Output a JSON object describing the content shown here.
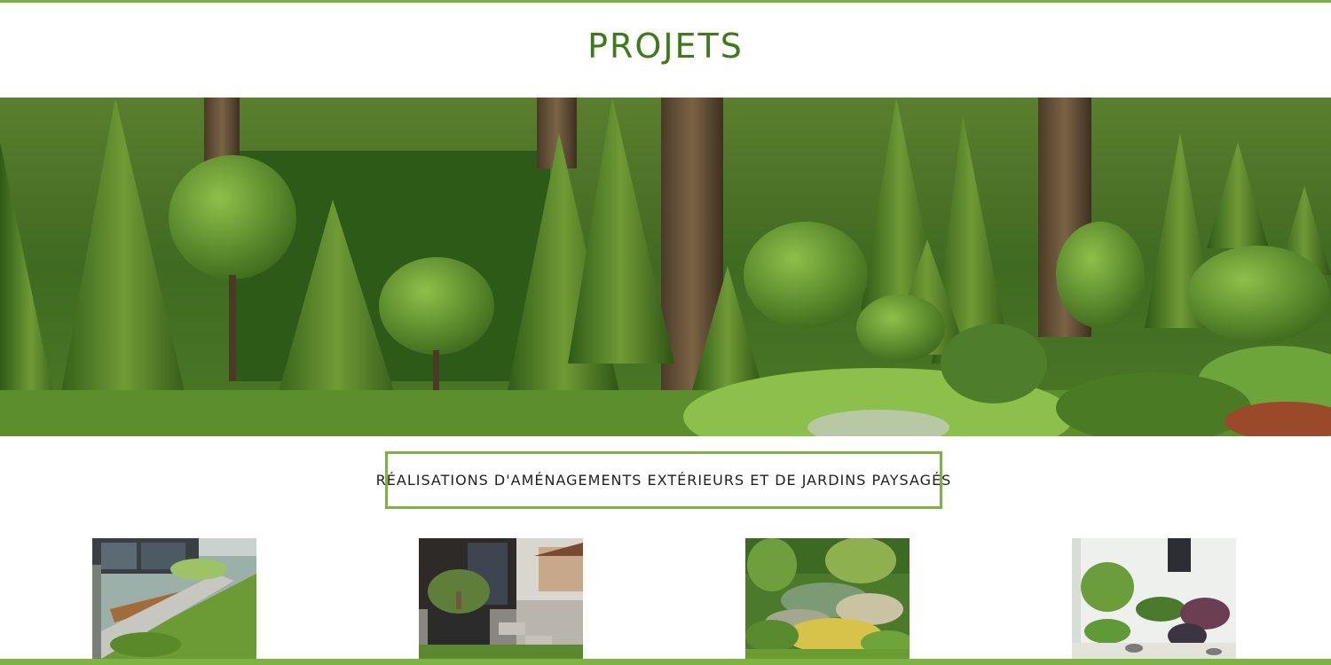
{
  "page": {
    "title": "Projets",
    "subtitle": "Réalisations d'aménagements extérieurs et de jardins paysagés"
  },
  "colors": {
    "accent": "#7cb342",
    "title": "#3c7a1a"
  },
  "hero": {
    "image": "topiary-garden-image"
  },
  "thumbnails": [
    {
      "image": "modern-lawn-garden-image"
    },
    {
      "image": "terrace-planter-image"
    },
    {
      "image": "rock-garden-image"
    },
    {
      "image": "white-wall-garden-image"
    }
  ]
}
